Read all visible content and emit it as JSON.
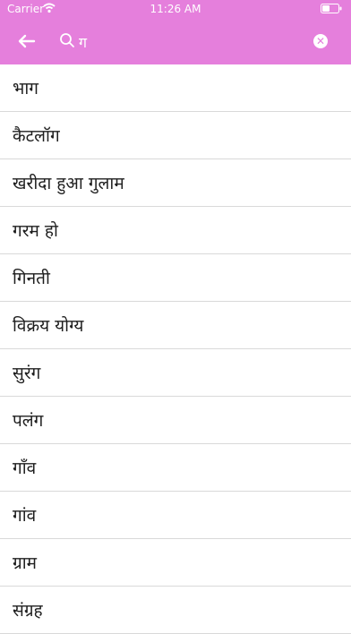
{
  "status_bar": {
    "carrier": "Carrier",
    "time": "11:26 AM"
  },
  "header": {
    "search": {
      "value": "ग",
      "placeholder": ""
    },
    "accent_color": "#e57fdc"
  },
  "results": [
    {
      "label": "भाग"
    },
    {
      "label": "कैटलॉग"
    },
    {
      "label": "खरीदा हुआ गुलाम"
    },
    {
      "label": "गरम हो"
    },
    {
      "label": "गिनती"
    },
    {
      "label": "विक्रय योग्य"
    },
    {
      "label": "सुरंग"
    },
    {
      "label": "पलंग"
    },
    {
      "label": "गाँव"
    },
    {
      "label": "गांव"
    },
    {
      "label": "ग्राम"
    },
    {
      "label": "संग्रह"
    }
  ]
}
